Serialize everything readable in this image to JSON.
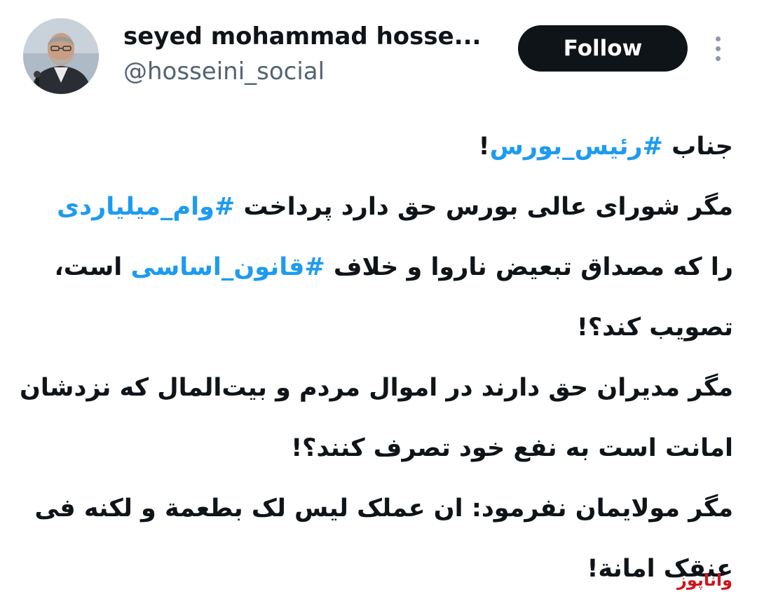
{
  "profile": {
    "display_name": "seyed mohammad hosse...",
    "handle": "@hosseini_social",
    "avatar_icon": "profile-photo"
  },
  "actions": {
    "follow_label": "Follow",
    "more_icon": "more-vertical-icon"
  },
  "tweet": {
    "lines": [
      [
        {
          "text": "جناب "
        },
        {
          "text": "#رئیس_بورس",
          "hashtag": true
        },
        {
          "text": "!"
        }
      ],
      [
        {
          "text": "مگر شورای عالی بورس حق دارد پرداخت "
        },
        {
          "text": "#وام_میلیاردی",
          "hashtag": true
        }
      ],
      [
        {
          "text": "را که مصداق تبعیض ناروا و خلاف "
        },
        {
          "text": "#قانون_اساسی",
          "hashtag": true
        },
        {
          "text": " است،"
        }
      ],
      [
        {
          "text": "تصویب کند؟!"
        }
      ],
      [
        {
          "text": "مگر مدیران حق دارند در اموال مردم و بیت‌المال که نزدشان"
        }
      ],
      [
        {
          "text": "امانت است به نفع خود تصرف کنند؟!"
        }
      ],
      [
        {
          "text": "مگر مولایمان نفرمود: ان عملک لیس لک بطعمة و لکنه فی"
        }
      ],
      [
        {
          "text": "عنقک امانة!"
        }
      ]
    ]
  },
  "watermark": {
    "text": "واناپوز",
    "color": "#d0141c"
  },
  "colors": {
    "hashtag": "#1d9bf0",
    "text": "#0f1419",
    "secondary": "#536471",
    "follow_bg": "#0f1419"
  }
}
